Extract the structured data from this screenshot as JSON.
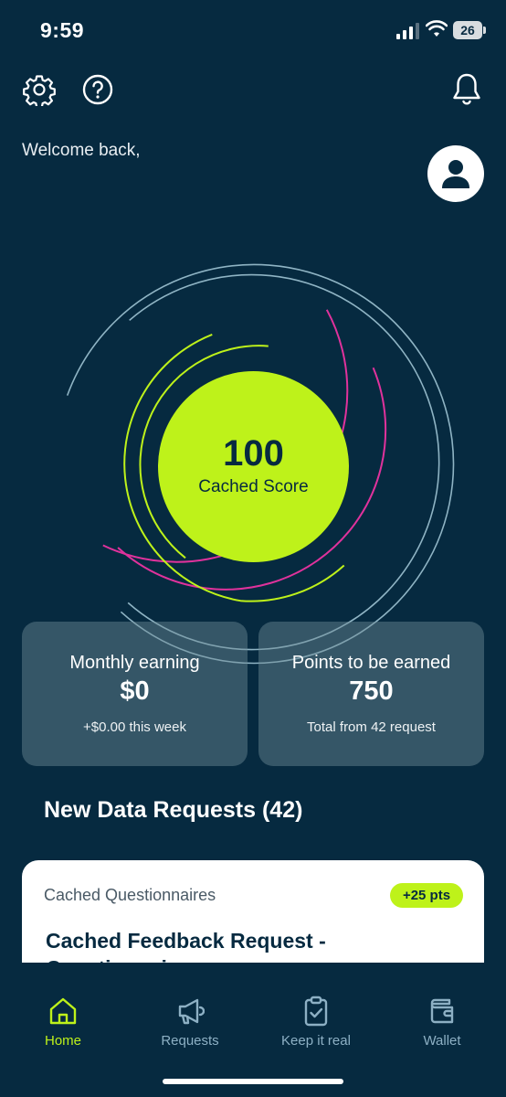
{
  "status": {
    "time": "9:59",
    "battery": "26"
  },
  "header": {
    "welcome": "Welcome back,"
  },
  "score": {
    "value": "100",
    "label": "Cached Score"
  },
  "stats": [
    {
      "title": "Monthly earning",
      "value": "$0",
      "sub": "+$0.00 this week"
    },
    {
      "title": "Points to be earned",
      "value": "750",
      "sub": "Total from 42 request"
    }
  ],
  "requests": {
    "section_title": "New Data Requests (42)",
    "items": [
      {
        "category": "Cached Questionnaires",
        "points": "+25 pts",
        "title": "Cached Feedback Request - Questionnaires"
      }
    ]
  },
  "nav": [
    {
      "label": "Home",
      "icon": "home-icon",
      "active": true
    },
    {
      "label": "Requests",
      "icon": "megaphone-icon",
      "active": false
    },
    {
      "label": "Keep it real",
      "icon": "clipboard-check-icon",
      "active": false
    },
    {
      "label": "Wallet",
      "icon": "wallet-icon",
      "active": false
    }
  ],
  "colors": {
    "background": "#062a40",
    "accent": "#bef21a",
    "pink": "#e0329c",
    "ring": "#8fb4c4"
  }
}
